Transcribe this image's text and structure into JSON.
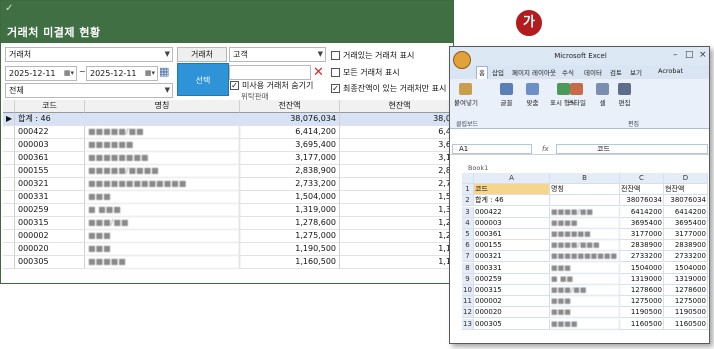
{
  "app": {
    "title": "거래처 미결제 현황",
    "lang_button": "가",
    "filters": {
      "customer_select_label": "거래처",
      "customer_field_label": "거래처",
      "customer_field_value": "고객",
      "date_from": "2025-12-11",
      "date_to": "2025-12-11",
      "date_separator": "~",
      "type_select": "전체",
      "select_button": "선택",
      "hide_unused_label": "미사용 거래처 숨기기",
      "hide_unused_checked": true,
      "consignment_label": "위탁판매",
      "show_with_trade_label": "거래있는 거래처 표시",
      "show_all_label": "모든 거래처 표시",
      "show_final_balance_label": "최종잔액이 있는 거래처만 표시",
      "show_final_balance_checked": true
    },
    "grid": {
      "headers": [
        "코드",
        "명칭",
        "전잔액",
        "현잔액"
      ],
      "summary": {
        "label": "합계 : 46",
        "prev": "38,076,034",
        "curr": "38,07"
      },
      "rows": [
        {
          "code": "000422",
          "name": "■■■■■/■■",
          "prev": "6,414,200",
          "curr": "6,41"
        },
        {
          "code": "000003",
          "name": "■■■■■■",
          "prev": "3,695,400",
          "curr": "3,69"
        },
        {
          "code": "000361",
          "name": "■■■■■■■■",
          "prev": "3,177,000",
          "curr": "3,17"
        },
        {
          "code": "000155",
          "name": "■■■■■/■■■■",
          "prev": "2,838,900",
          "curr": "2,83"
        },
        {
          "code": "000321",
          "name": "■■■■■■■■■■■■■",
          "prev": "2,733,200",
          "curr": "2,73"
        },
        {
          "code": "000331",
          "name": "■■■",
          "prev": "1,504,000",
          "curr": "1,50"
        },
        {
          "code": "000259",
          "name": "■ ■■■",
          "prev": "1,319,000",
          "curr": "1,31"
        },
        {
          "code": "000315",
          "name": "■■■/■■",
          "prev": "1,278,600",
          "curr": "1,27"
        },
        {
          "code": "000002",
          "name": "■■■",
          "prev": "1,275,000",
          "curr": "1,27"
        },
        {
          "code": "000020",
          "name": "■■■",
          "prev": "1,190,500",
          "curr": "1,19"
        },
        {
          "code": "000305",
          "name": "■■■■■",
          "prev": "1,160,500",
          "curr": "1,16"
        }
      ]
    }
  },
  "excel": {
    "title": "Microsoft Excel",
    "tabs": [
      "홈",
      "삽입",
      "페이지 레이아웃",
      "수식",
      "데이터",
      "검토",
      "보기",
      "Acrobat"
    ],
    "ribbon_groups": [
      "붙여넣기",
      "글꼴",
      "맞춤",
      "표시 형식",
      "스타일",
      "셀",
      "편집"
    ],
    "ribbon_labels": [
      "클립보드",
      "편집"
    ],
    "name_box": "A1",
    "formula_value": "코드",
    "book_name": "Book1",
    "col_headers": [
      "A",
      "B",
      "C",
      "D"
    ],
    "rows": [
      [
        "코드",
        "명칭",
        "전잔액",
        "현잔액"
      ],
      [
        "합계 : 46",
        "",
        "38076034",
        "38076034"
      ],
      [
        "000422",
        "■■■■/■■",
        "6414200",
        "6414200"
      ],
      [
        "000003",
        "■■■■",
        "3695400",
        "3695400"
      ],
      [
        "000361",
        "■■■■■■",
        "3177000",
        "3177000"
      ],
      [
        "000155",
        "■■■■/■■■",
        "2838900",
        "2838900"
      ],
      [
        "000321",
        "■■■■■■■■■■",
        "2733200",
        "2733200"
      ],
      [
        "000331",
        "■■■",
        "1504000",
        "1504000"
      ],
      [
        "000259",
        "■ ■■",
        "1319000",
        "1319000"
      ],
      [
        "000315",
        "■■■/■■",
        "1278600",
        "1278600"
      ],
      [
        "000002",
        "■■■",
        "1275000",
        "1275000"
      ],
      [
        "000020",
        "■■■",
        "1190500",
        "1190500"
      ],
      [
        "000305",
        "■■■■",
        "1160500",
        "1160500"
      ]
    ]
  },
  "colors": {
    "title_bg": "#3f6f42",
    "select_button": "#2f93d8",
    "lang_button": "#b21c1c",
    "summary_row": "#d7e2f5"
  }
}
